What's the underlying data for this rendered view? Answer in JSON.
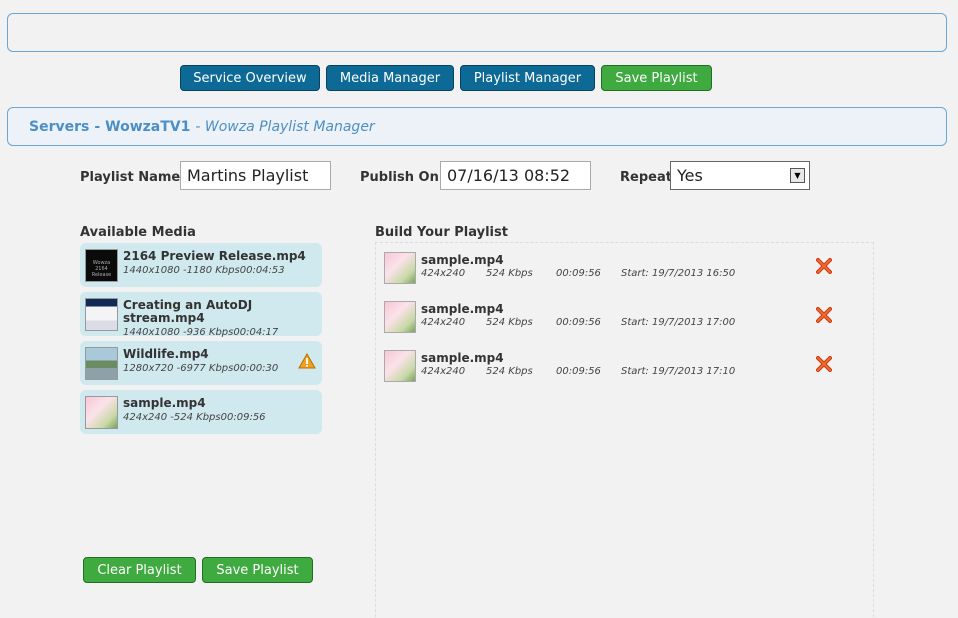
{
  "nav": {
    "service_overview": "Service Overview",
    "media_manager": "Media Manager",
    "playlist_manager": "Playlist Manager",
    "save_playlist": "Save Playlist"
  },
  "header": {
    "servers": "Servers",
    "separator": "-",
    "server_name": "WowzaTV1",
    "subtitle": "- Wowza Playlist Manager"
  },
  "form": {
    "playlist_name_label": "Playlist Name:",
    "playlist_name_value": "Martins Playlist",
    "publish_on_label": "Publish On:",
    "publish_on_value": "07/16/13 08:52",
    "repeat_label": "Repeat",
    "repeat_value": "Yes"
  },
  "available_media": {
    "title": "Available Media",
    "items": [
      {
        "name": "2164 Preview Release.mp4",
        "resolution": "1440x1080",
        "bitrate": "-1180 Kbps",
        "duration": "00:04:53",
        "thumb_text": "Wowza 2164 Release",
        "thumb_style": "dark"
      },
      {
        "name": "Creating an AutoDJ stream.mp4",
        "resolution": "1440x1080",
        "bitrate": "-936 Kbps",
        "duration": "00:04:17",
        "thumb_style": "screen"
      },
      {
        "name": "Wildlife.mp4",
        "resolution": "1280x720",
        "bitrate": "-6977 Kbps",
        "duration": "00:00:30",
        "thumb_style": "wild",
        "warning_icon": "warning-icon"
      },
      {
        "name": "sample.mp4",
        "resolution": "424x240",
        "bitrate": "-524 Kbps",
        "duration": "00:09:56",
        "thumb_style": "sample"
      }
    ]
  },
  "playlist": {
    "title": "Build Your Playlist",
    "items": [
      {
        "name": "sample.mp4",
        "resolution": "424x240",
        "bitrate": "524 Kbps",
        "duration": "00:09:56",
        "start": "Start: 19/7/2013 16:50"
      },
      {
        "name": "sample.mp4",
        "resolution": "424x240",
        "bitrate": "524 Kbps",
        "duration": "00:09:56",
        "start": "Start: 19/7/2013 17:00"
      },
      {
        "name": "sample.mp4",
        "resolution": "424x240",
        "bitrate": "524 Kbps",
        "duration": "00:09:56",
        "start": "Start: 19/7/2013 17:10"
      }
    ],
    "delete_icon": "delete-icon"
  },
  "actions": {
    "clear_playlist": "Clear Playlist",
    "save_playlist": "Save Playlist"
  },
  "colors": {
    "nav_blue": "#0d6a96",
    "save_green": "#3faa3f",
    "header_text": "#4c8fc6",
    "media_item_bg": "#cfe9ee"
  }
}
